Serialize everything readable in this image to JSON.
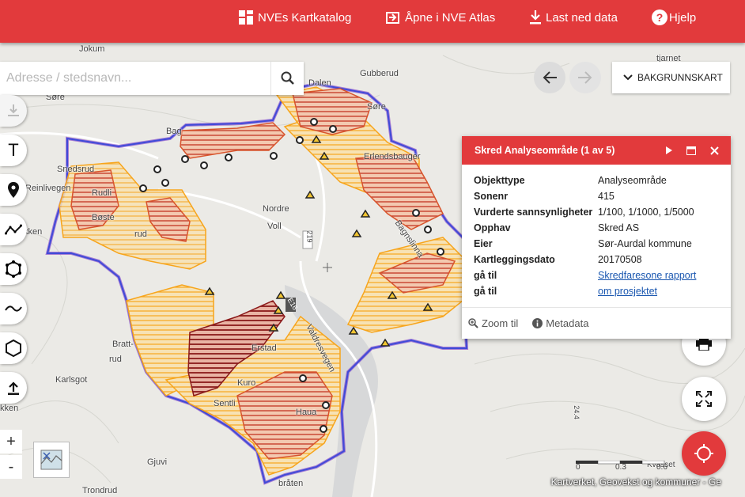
{
  "topbar": {
    "catalog": "NVEs Kartkatalog",
    "atlas": "Åpne i NVE Atlas",
    "download": "Last ned data",
    "help": "Hjelp"
  },
  "search": {
    "placeholder": "Adresse / stedsnavn..."
  },
  "background_button": "BAKGRUNNSKART",
  "places": {
    "jokum": "Jokum",
    "dalen": "Dalen",
    "gubberud": "Gubberud",
    "sore1": "Søre",
    "sore2": "Søre",
    "bag": "Bag",
    "tjarnet": "tjarnet",
    "snedsrud": "Snedsrud",
    "reinlivegen": "Reinlivegen",
    "rudli": "Rudli",
    "nordre": "Nordre",
    "voll": "Voll",
    "erlendsbauger": "Erlendsbauger",
    "kken1": "kken",
    "rud": "rud",
    "baste": "Bøste",
    "bagnslinna": "Bagnslinna",
    "bratt": "Bratt-",
    "rud2": "rud",
    "erstad": "Erstad",
    "valdresvegen": "Valdresvegen",
    "karlsgot": "Karlsgot",
    "kuro": "Kuro",
    "haua": "Haua",
    "sentli": "Sentli",
    "gjuvi": "Gjuvi",
    "trondrud": "Trondrud",
    "brAten": "bråten",
    "kken2": "kken",
    "road219": "219",
    "e16": "E16",
    "road244": "24.4",
    "kvasset": "Kvasset"
  },
  "popup": {
    "title": "Skred Analyseområde (1 av 5)",
    "rows": [
      {
        "k": "Objekttype",
        "v": "Analyseområde"
      },
      {
        "k": "Sonenr",
        "v": "415"
      },
      {
        "k": "Vurderte sannsynligheter",
        "v": "1/100, 1/1000, 1/5000"
      },
      {
        "k": "Opphav",
        "v": "Skred AS"
      },
      {
        "k": "Eier",
        "v": "Sør-Aurdal kommune"
      },
      {
        "k": "Kartleggingsdato",
        "v": "20170508"
      },
      {
        "k": "gå til",
        "v": " Skredfaresone rapport"
      },
      {
        "k": "gå til",
        "v": " om prosjektet"
      }
    ],
    "zoom_label": "Zoom til",
    "metadata_label": "Metadata"
  },
  "zoom": {
    "plus": "+",
    "minus": "-"
  },
  "scale": {
    "zero": "0",
    "mid": "0.3",
    "end": "0.6"
  },
  "attribution": "Kartverket, Geovekst og kommuner - Ge",
  "colors": {
    "brand_red": "#e23a3c",
    "hazard_outline": "#3f4bd8",
    "hazard_orange": "#f7a51c",
    "hazard_red": "#c8402c",
    "hazard_dark_red": "#8b1a1a"
  },
  "icons": {
    "catalog": "grid-icon",
    "atlas": "open-external-icon",
    "download": "download-icon",
    "help": "help-icon",
    "search": "search-icon",
    "back": "arrow-left-icon",
    "forward": "arrow-right-icon",
    "chevron": "chevron-down-icon"
  }
}
